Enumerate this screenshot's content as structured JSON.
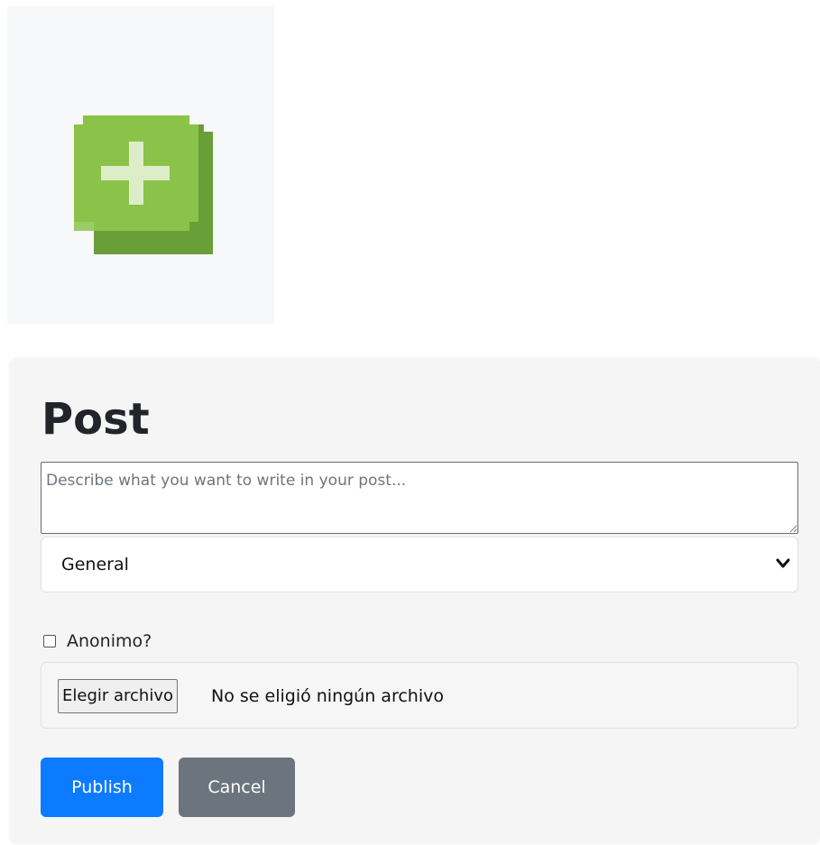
{
  "add_post_icon": {
    "icon": "plus-icon",
    "colors": {
      "panel_bg": "#f7f8fa",
      "face": "#8bc34a",
      "shadow": "#689f38",
      "plus": "#dcedc8"
    }
  },
  "post_form": {
    "title": "Post",
    "textarea_placeholder": "Describe what you want to write in your post...",
    "textarea_value": "",
    "category_selected": "General",
    "anonymous_label": "Anonimo?",
    "anonymous_checked": false,
    "file_button_label": "Elegir archivo",
    "file_status": "No se eligió ningún archivo",
    "publish_label": "Publish",
    "cancel_label": "Cancel",
    "colors": {
      "publish": "#0d7bff",
      "cancel": "#6c757d",
      "card_bg": "#f5f5f5"
    }
  }
}
